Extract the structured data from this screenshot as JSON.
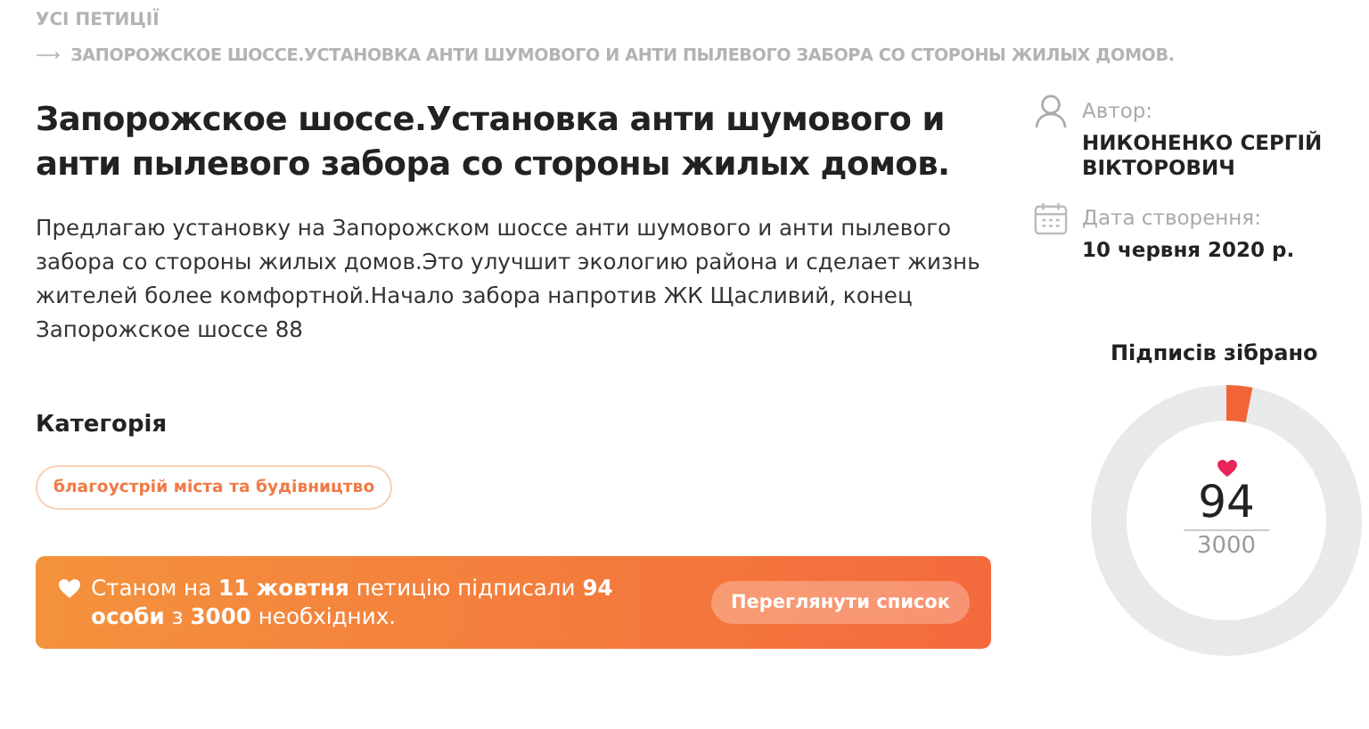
{
  "breadcrumbs": {
    "root": "УСІ ПЕТИЦІЇ",
    "arrow": "⟶",
    "current": "ЗАПОРОЖСКОЕ ШОССЕ.УСТАНОВКА АНТИ ШУМОВОГО И АНТИ ПЫЛЕВОГО ЗАБОРА СО СТОРОНЫ ЖИЛЫХ ДОМОВ."
  },
  "title": "Запорожское шоссе.Установка анти шумового и анти пылевого забора со стороны жилых домов.",
  "description": "Предлагаю установку на Запорожском шоссе анти шумового и анти пылевого забора со стороны жилых домов.Это улучшит экологию района и сделает жизнь жителей более комфортной.Начало забора напротив ЖК Щасливий, конец Запорожское шоссе 88",
  "category": {
    "heading": "Категорія",
    "tag": "благоустрій міста та будівництво"
  },
  "status": {
    "text": "Станом на **11 жовтня** петицію підписали **94 особи** з **3000** необхідних.",
    "button": "Переглянути список"
  },
  "meta": [
    {
      "kind": "author",
      "label": "Автор:",
      "value": "НИКОНЕНКО СЕРГІЙ ВІКТОРОВИЧ"
    },
    {
      "kind": "date",
      "label": "Дата створення:",
      "value": "10 червня 2020 р."
    }
  ],
  "signatures": {
    "heading": "Підписів зібрано",
    "count": "94",
    "goal": "3000",
    "level": 0.031
  }
}
